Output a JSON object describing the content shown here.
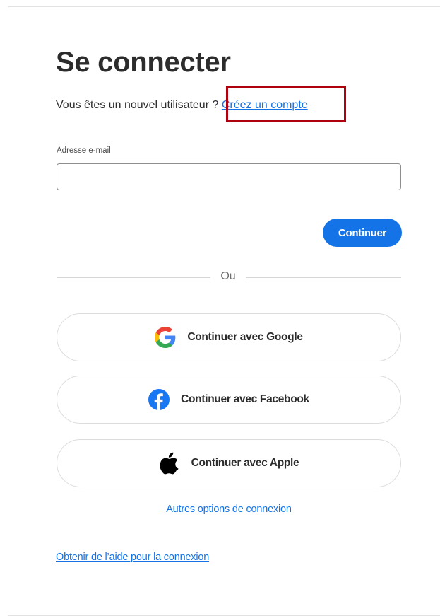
{
  "page": {
    "title": "Se connecter",
    "new_user_prompt": "Vous êtes un nouvel utilisateur ? ",
    "create_account_link": "Créez un compte"
  },
  "form": {
    "email_label": "Adresse e-mail",
    "email_value": "",
    "continue_label": "Continuer"
  },
  "divider": {
    "or_label": "Ou"
  },
  "social": {
    "google_label": "Continuer avec Google",
    "facebook_label": "Continuer avec Facebook",
    "apple_label": "Continuer avec Apple"
  },
  "links": {
    "other_options": "Autres options de connexion",
    "help": "Obtenir de l’aide pour la connexion"
  },
  "colors": {
    "accent": "#1473e6",
    "highlight_box": "#b0000d",
    "facebook": "#1877f2"
  },
  "icons": {
    "google": "google-icon",
    "facebook": "facebook-icon",
    "apple": "apple-icon"
  }
}
